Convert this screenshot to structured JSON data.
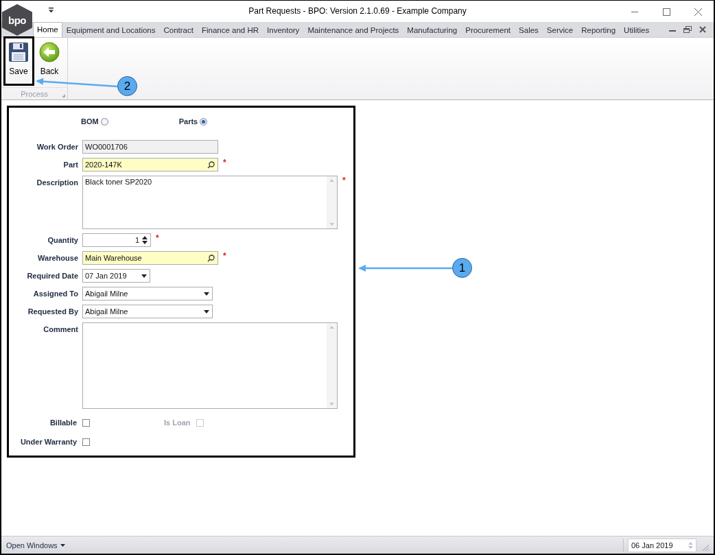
{
  "window": {
    "title": "Part Requests - BPO: Version 2.1.0.69 - Example Company",
    "logo_text": "bpo"
  },
  "tabs": [
    {
      "label": "Home",
      "selected": true
    },
    {
      "label": "Equipment and Locations",
      "selected": false
    },
    {
      "label": "Contract",
      "selected": false
    },
    {
      "label": "Finance and HR",
      "selected": false
    },
    {
      "label": "Inventory",
      "selected": false
    },
    {
      "label": "Maintenance and Projects",
      "selected": false
    },
    {
      "label": "Manufacturing",
      "selected": false
    },
    {
      "label": "Procurement",
      "selected": false
    },
    {
      "label": "Sales",
      "selected": false
    },
    {
      "label": "Service",
      "selected": false
    },
    {
      "label": "Reporting",
      "selected": false
    },
    {
      "label": "Utilities",
      "selected": false
    }
  ],
  "ribbon": {
    "group": "Process",
    "buttons": [
      {
        "kind": "save",
        "label": "Save"
      },
      {
        "kind": "back",
        "label": "Back"
      }
    ]
  },
  "form": {
    "radios": [
      {
        "label": "BOM",
        "selected": false
      },
      {
        "label": "Parts",
        "selected": true
      }
    ],
    "fields": [
      {
        "kind": "text",
        "label": "Work Order",
        "value": "WO0001706",
        "readonly": true
      },
      {
        "kind": "lookup",
        "label": "Part",
        "value": "2020-147K",
        "required_mark": "*"
      },
      {
        "kind": "memo",
        "label": "Description",
        "value": "Black toner SP2020",
        "required_mark": "*"
      },
      {
        "kind": "spin",
        "label": "Quantity",
        "value": "1",
        "required_mark": "*"
      },
      {
        "kind": "lookup",
        "label": "Warehouse",
        "value": "Main Warehouse",
        "required_mark": "*"
      },
      {
        "kind": "date",
        "label": "Required Date",
        "value": "07 Jan 2019"
      },
      {
        "kind": "combo",
        "label": "Assigned To",
        "value": "Abigail Milne"
      },
      {
        "kind": "combo",
        "label": "Requested By",
        "value": "Abigail Milne"
      },
      {
        "kind": "memo",
        "label": "Comment"
      }
    ],
    "check_rows": [
      {
        "items": [
          {
            "label": "Billable",
            "checked": false,
            "disabled": false
          },
          {
            "label": "Is Loan",
            "checked": false,
            "disabled": true
          }
        ]
      },
      {
        "items": [
          {
            "label": "Under Warranty",
            "checked": false,
            "disabled": false
          }
        ]
      }
    ]
  },
  "status_bar": {
    "open_windows": "Open Windows",
    "date": "06 Jan 2019"
  },
  "callouts": [
    {
      "number": "1"
    },
    {
      "number": "2"
    }
  ]
}
